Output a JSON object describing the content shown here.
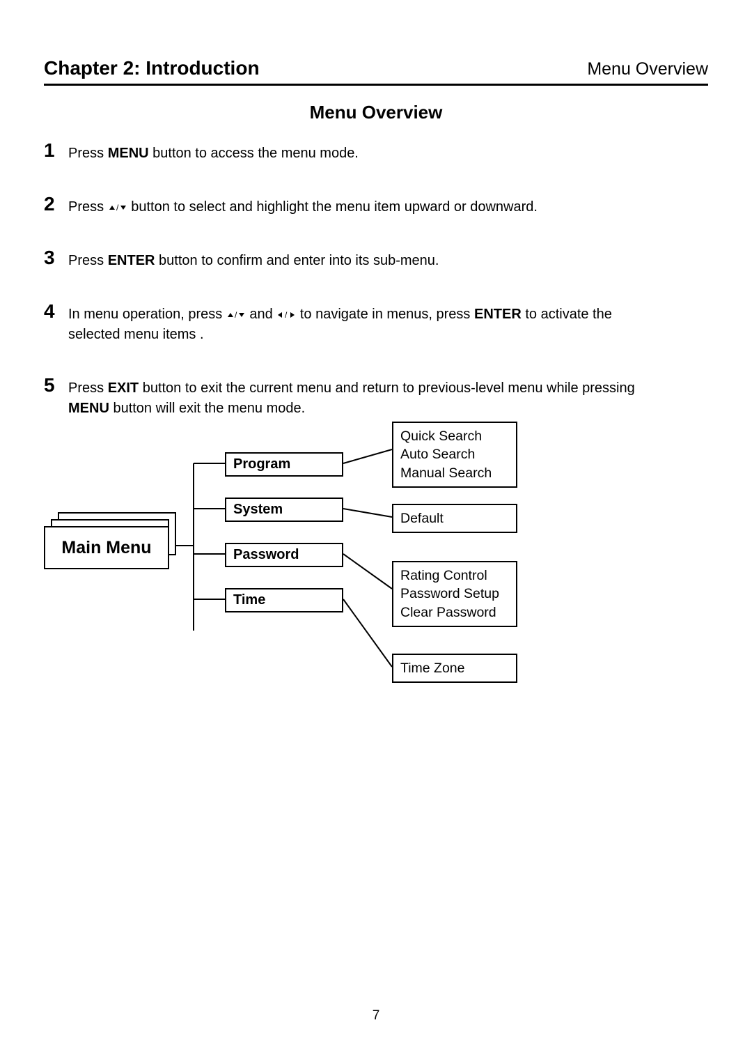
{
  "header": {
    "chapter": "Chapter 2: Introduction",
    "crumb": "Menu Overview"
  },
  "section_title": "Menu Overview",
  "steps": [
    {
      "num": "1",
      "pre": "Press ",
      "b1": "MENU",
      "post": " button to access the menu mode."
    },
    {
      "num": "2",
      "pre": "Press ",
      "arrows": "ud",
      "post": " button to select and highlight the menu item upward or downward."
    },
    {
      "num": "3",
      "pre": "Press ",
      "b1": "ENTER",
      "post": " button to confirm and enter into its sub-menu."
    },
    {
      "num": "4",
      "pre": "In menu operation, press ",
      "arrows": "ud",
      "mid": " and ",
      "arrows2": "lr",
      "mid2": " to navigate in menus, press ",
      "b1": "ENTER",
      "post": " to activate the selected menu items ."
    },
    {
      "num": "5",
      "pre": "Press ",
      "b1": "EXIT",
      "mid": " button to exit the current menu and return to previous-level menu while pressing ",
      "b2": "MENU",
      "post": " button will exit the menu mode."
    }
  ],
  "diagram": {
    "root": "Main Menu",
    "mids": [
      "Program",
      "System",
      "Password",
      "Time"
    ],
    "leaves": {
      "program": [
        "Quick Search",
        "Auto Search",
        "Manual Search"
      ],
      "system": [
        "Default"
      ],
      "password": [
        "Rating Control",
        "Password Setup",
        "Clear Password"
      ],
      "time": [
        "Time Zone"
      ]
    }
  },
  "page_number": "7"
}
